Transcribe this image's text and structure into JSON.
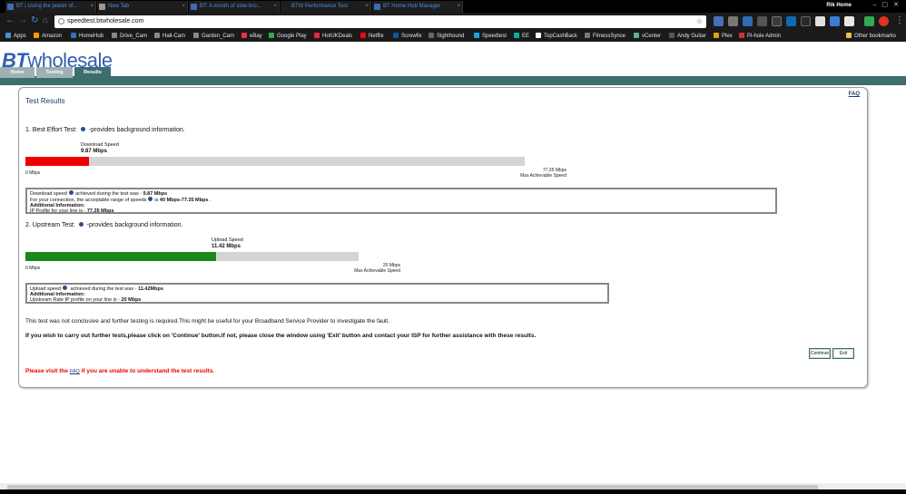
{
  "browser": {
    "tabs": [
      {
        "title": "BT | Using the power of..."
      },
      {
        "title": "New Tab"
      },
      {
        "title": "BT: A month of slow bro..."
      },
      {
        "title": "BTW Performance Test"
      },
      {
        "title": "BT Home Hub Manager"
      }
    ],
    "profile_name": "Rik Home",
    "url": "speedtest.btwholesale.com",
    "bookmarks": [
      {
        "label": "Apps",
        "color": "#4d8fd6"
      },
      {
        "label": "Amazon",
        "color": "#f90"
      },
      {
        "label": "HomeHub",
        "color": "#3b6cb5"
      },
      {
        "label": "Drive_Cam",
        "color": "#888"
      },
      {
        "label": "Hall-Cam",
        "color": "#888"
      },
      {
        "label": "Garden_Cam",
        "color": "#888"
      },
      {
        "label": "eBay",
        "color": "#e53238"
      },
      {
        "label": "Google Play",
        "color": "#34a853"
      },
      {
        "label": "HotUKDeals",
        "color": "#e24"
      },
      {
        "label": "Netflix",
        "color": "#e50914"
      },
      {
        "label": "Screwfix",
        "color": "#0a5aa0"
      },
      {
        "label": "Sighthound",
        "color": "#666"
      },
      {
        "label": "Speedtest",
        "color": "#1aa3d9"
      },
      {
        "label": "EE",
        "color": "#00b2a9"
      },
      {
        "label": "TopCashBack",
        "color": "#fff"
      },
      {
        "label": "FitnessSynce",
        "color": "#777"
      },
      {
        "label": "vCenter",
        "color": "#6a9"
      },
      {
        "label": "Andy Guitar",
        "color": "#555"
      },
      {
        "label": "Plex",
        "color": "#e5a00d"
      },
      {
        "label": "Pi-hole Admin",
        "color": "#c33"
      }
    ],
    "other_bookmarks": "Other bookmarks"
  },
  "site": {
    "logo_bt": "BT",
    "logo_rest": "wholesale",
    "nav_tabs": [
      {
        "label": "Home"
      },
      {
        "label": "Testing"
      },
      {
        "label": "Results"
      }
    ]
  },
  "results": {
    "faq_link": "FAQ",
    "title": "Test Results",
    "best_effort": {
      "heading": "1. Best Effort Test:",
      "heading_suffix": "-provides background information.",
      "caption_label": "Download Speed",
      "caption_value": "9.87 Mbps",
      "measured_mbps": 9.87,
      "max_mbps": 77.35,
      "fill_color": "#ee0000",
      "axis_min": "0 Mbps",
      "axis_max": "77.35 Mbps",
      "axis_max_label": "Max Achievable Speed",
      "info_line1_prefix": "Download speed",
      "info_line1_mid": "achieved during the test was - ",
      "info_line1_value": "9.87 Mbps",
      "info_line2_prefix": "For your connection, the acceptable range of speeds",
      "info_line2_mid": "is ",
      "info_line2_value": "40 Mbps-77.35 Mbps",
      "info_line2_suffix": " .",
      "info_line3": "Additional Information:",
      "info_line4_prefix": "IP Profile for your line is - ",
      "info_line4_value": "77.35 Mbps"
    },
    "upstream": {
      "heading": "2. Upstream Test:",
      "heading_suffix": "-provides background information.",
      "caption_label": "Upload Speed",
      "caption_value": "11.42 Mbps",
      "measured_mbps": 11.42,
      "max_mbps": 20,
      "fill_color": "#1a8a1a",
      "axis_min": "0 Mbps",
      "axis_max": "20 Mbps",
      "axis_max_label": "Max Achievable Speed",
      "info_line1_prefix": "Upload speed",
      "info_line1_mid": " achieved during the test was - ",
      "info_line1_value": "11.42Mbps",
      "info_line2": "Additional Information:",
      "info_line3_prefix": "Upstream Rate IP profile on your line is - ",
      "info_line3_value": "20 Mbps"
    },
    "note_inconclusive": "This test was not conclusive and further testing is required.This might be useful for your Broadband Service Provider to investigate the fault.",
    "note_continue": "If you wish to carry out further tests,please click on 'Continue' button.If not, please close the window using 'Exit' button and contact your ISP for further assistance with these results.",
    "continue_button": "Continue",
    "exit_button": "Exit",
    "visit_prefix": "Please visit the ",
    "visit_link": "FAQ",
    "visit_suffix": " if you are unable to understand the test results."
  }
}
